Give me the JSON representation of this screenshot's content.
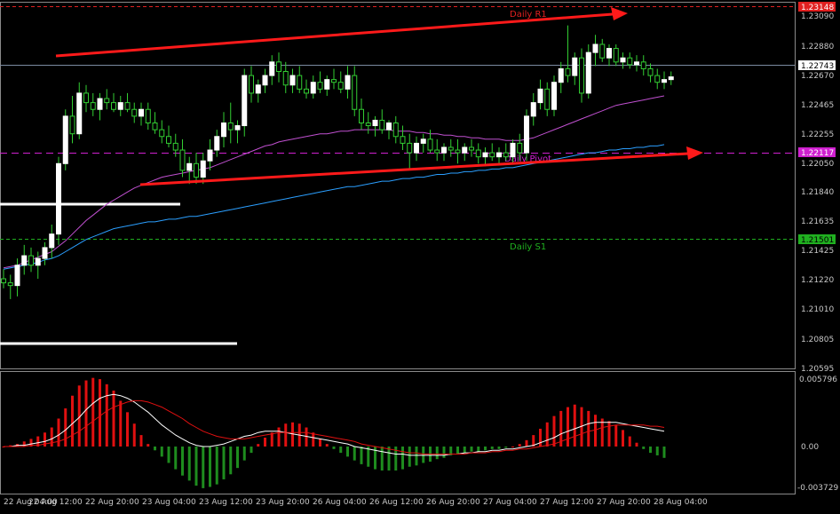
{
  "chart_data": [
    {
      "type": "candlestick",
      "panel": "price",
      "ylim": [
        1.20595,
        1.23255
      ],
      "price_labels": [
        "1.23090",
        "1.22880",
        "1.22670",
        "1.22465",
        "1.22255",
        "1.22050",
        "1.21840",
        "1.21635",
        "1.21425",
        "1.21220",
        "1.21010",
        "1.20805",
        "1.20595"
      ],
      "levels": [
        {
          "name": "Daily R1",
          "value": 1.23148,
          "label": "Daily R1",
          "tag": "1.23148",
          "color": "#e02020"
        },
        {
          "name": "current",
          "value": 1.22743,
          "label": "",
          "tag": "1.22743",
          "color": "#ffffff"
        },
        {
          "name": "Daily Pivot",
          "value": 1.22117,
          "label": "Daily Pivot",
          "tag": "1.22117",
          "color": "#d020d0"
        },
        {
          "name": "Daily S1",
          "value": 1.21501,
          "label": "Daily S1",
          "tag": "1.21501",
          "color": "#20b020"
        }
      ],
      "candles": [
        [
          1.2125,
          1.2132,
          1.2118,
          1.2122
        ],
        [
          1.2122,
          1.2128,
          1.211,
          1.212
        ],
        [
          1.212,
          1.214,
          1.2112,
          1.2135
        ],
        [
          1.2135,
          1.215,
          1.2128,
          1.2142
        ],
        [
          1.2142,
          1.2148,
          1.213,
          1.2135
        ],
        [
          1.2135,
          1.2145,
          1.2125,
          1.214
        ],
        [
          1.214,
          1.2152,
          1.2135,
          1.2148
        ],
        [
          1.2148,
          1.2165,
          1.214,
          1.2158
        ],
        [
          1.2158,
          1.2215,
          1.215,
          1.221
        ],
        [
          1.221,
          1.225,
          1.2205,
          1.2245
        ],
        [
          1.2245,
          1.226,
          1.2225,
          1.2232
        ],
        [
          1.2232,
          1.227,
          1.2228,
          1.2262
        ],
        [
          1.2262,
          1.2268,
          1.2248,
          1.2255
        ],
        [
          1.2255,
          1.2262,
          1.2245,
          1.225
        ],
        [
          1.225,
          1.2262,
          1.2242,
          1.2258
        ],
        [
          1.2258,
          1.2265,
          1.225,
          1.2255
        ],
        [
          1.2255,
          1.2262,
          1.2248,
          1.225
        ],
        [
          1.225,
          1.226,
          1.2245,
          1.2255
        ],
        [
          1.2255,
          1.2262,
          1.2248,
          1.225
        ],
        [
          1.225,
          1.2255,
          1.224,
          1.2245
        ],
        [
          1.2245,
          1.2255,
          1.2238,
          1.225
        ],
        [
          1.225,
          1.2255,
          1.2235,
          1.224
        ],
        [
          1.224,
          1.2248,
          1.2232,
          1.2235
        ],
        [
          1.2235,
          1.2242,
          1.2225,
          1.223
        ],
        [
          1.223,
          1.2238,
          1.2222,
          1.2225
        ],
        [
          1.2225,
          1.2232,
          1.2215,
          1.222
        ],
        [
          1.222,
          1.2228,
          1.22,
          1.2205
        ],
        [
          1.2205,
          1.2215,
          1.2195,
          1.221
        ],
        [
          1.221,
          1.2218,
          1.2195,
          1.22
        ],
        [
          1.22,
          1.2218,
          1.2195,
          1.2212
        ],
        [
          1.2212,
          1.2228,
          1.2205,
          1.222
        ],
        [
          1.222,
          1.2235,
          1.2215,
          1.223
        ],
        [
          1.223,
          1.2248,
          1.2222,
          1.224
        ],
        [
          1.224,
          1.2255,
          1.2225,
          1.2235
        ],
        [
          1.2235,
          1.2242,
          1.2225,
          1.2238
        ],
        [
          1.2238,
          1.228,
          1.223,
          1.2275
        ],
        [
          1.2275,
          1.2282,
          1.2255,
          1.2262
        ],
        [
          1.2262,
          1.2272,
          1.2255,
          1.2268
        ],
        [
          1.2268,
          1.228,
          1.2262,
          1.2275
        ],
        [
          1.2275,
          1.229,
          1.2268,
          1.2285
        ],
        [
          1.2285,
          1.2292,
          1.227,
          1.2278
        ],
        [
          1.2278,
          1.2285,
          1.2262,
          1.2268
        ],
        [
          1.2268,
          1.228,
          1.2262,
          1.2275
        ],
        [
          1.2275,
          1.2282,
          1.2262,
          1.2265
        ],
        [
          1.2265,
          1.2272,
          1.2258,
          1.2262
        ],
        [
          1.2262,
          1.2275,
          1.2258,
          1.227
        ],
        [
          1.227,
          1.2278,
          1.2262,
          1.2265
        ],
        [
          1.2265,
          1.2275,
          1.226,
          1.2272
        ],
        [
          1.2272,
          1.228,
          1.2265,
          1.227
        ],
        [
          1.227,
          1.2278,
          1.2262,
          1.2265
        ],
        [
          1.2265,
          1.2282,
          1.2258,
          1.2275
        ],
        [
          1.2275,
          1.2282,
          1.2245,
          1.225
        ],
        [
          1.225,
          1.2258,
          1.2235,
          1.224
        ],
        [
          1.224,
          1.2248,
          1.2232,
          1.2238
        ],
        [
          1.2238,
          1.2245,
          1.223,
          1.2242
        ],
        [
          1.2242,
          1.225,
          1.2232,
          1.2235
        ],
        [
          1.2235,
          1.2242,
          1.2228,
          1.224
        ],
        [
          1.224,
          1.2245,
          1.2225,
          1.223
        ],
        [
          1.223,
          1.2238,
          1.222,
          1.2225
        ],
        [
          1.2225,
          1.2232,
          1.2205,
          1.2218
        ],
        [
          1.2218,
          1.223,
          1.2212,
          1.2225
        ],
        [
          1.2225,
          1.2232,
          1.2218,
          1.2228
        ],
        [
          1.2228,
          1.2235,
          1.2218,
          1.222
        ],
        [
          1.222,
          1.2228,
          1.2212,
          1.2218
        ],
        [
          1.2218,
          1.2225,
          1.2212,
          1.2222
        ],
        [
          1.2222,
          1.2228,
          1.2215,
          1.222
        ],
        [
          1.222,
          1.2228,
          1.221,
          1.2218
        ],
        [
          1.2218,
          1.2225,
          1.2212,
          1.2222
        ],
        [
          1.2222,
          1.2228,
          1.2215,
          1.222
        ],
        [
          1.222,
          1.2225,
          1.221,
          1.2215
        ],
        [
          1.2215,
          1.2222,
          1.2208,
          1.2218
        ],
        [
          1.2218,
          1.2225,
          1.2212,
          1.2215
        ],
        [
          1.2215,
          1.2222,
          1.221,
          1.2218
        ],
        [
          1.2218,
          1.2225,
          1.2212,
          1.2215
        ],
        [
          1.2215,
          1.2228,
          1.221,
          1.2225
        ],
        [
          1.2225,
          1.2232,
          1.2212,
          1.2218
        ],
        [
          1.2218,
          1.225,
          1.2212,
          1.2245
        ],
        [
          1.2245,
          1.2262,
          1.2238,
          1.2255
        ],
        [
          1.2255,
          1.2272,
          1.225,
          1.2265
        ],
        [
          1.2265,
          1.227,
          1.2245,
          1.225
        ],
        [
          1.225,
          1.2275,
          1.2245,
          1.227
        ],
        [
          1.227,
          1.2285,
          1.2262,
          1.228
        ],
        [
          1.228,
          1.2312,
          1.227,
          1.2275
        ],
        [
          1.2275,
          1.2292,
          1.2268,
          1.2288
        ],
        [
          1.2288,
          1.2295,
          1.2255,
          1.2262
        ],
        [
          1.2262,
          1.2298,
          1.2258,
          1.2292
        ],
        [
          1.2292,
          1.2305,
          1.2282,
          1.2298
        ],
        [
          1.2298,
          1.2302,
          1.2285,
          1.2288
        ],
        [
          1.2288,
          1.2298,
          1.2282,
          1.2295
        ],
        [
          1.2295,
          1.2298,
          1.2282,
          1.2285
        ],
        [
          1.2285,
          1.2292,
          1.228,
          1.2288
        ],
        [
          1.2288,
          1.2292,
          1.228,
          1.2283
        ],
        [
          1.2283,
          1.229,
          1.2278,
          1.2285
        ],
        [
          1.2285,
          1.229,
          1.2275,
          1.228
        ],
        [
          1.228,
          1.2284,
          1.227,
          1.2275
        ],
        [
          1.2275,
          1.228,
          1.2265,
          1.227
        ],
        [
          1.227,
          1.2278,
          1.2265,
          1.2272
        ],
        [
          1.2272,
          1.2278,
          1.2268,
          1.2274
        ]
      ],
      "ma_slow": [
        1.2132,
        1.2133,
        1.2134,
        1.2135,
        1.2136,
        1.2137,
        1.2139,
        1.214,
        1.2142,
        1.2145,
        1.2148,
        1.2151,
        1.2154,
        1.2156,
        1.2158,
        1.216,
        1.2162,
        1.2163,
        1.2164,
        1.2165,
        1.2166,
        1.2167,
        1.2167,
        1.2168,
        1.2169,
        1.2169,
        1.217,
        1.2171,
        1.2171,
        1.2172,
        1.2173,
        1.2174,
        1.2175,
        1.2176,
        1.2177,
        1.2178,
        1.2179,
        1.218,
        1.2181,
        1.2182,
        1.2183,
        1.2184,
        1.2185,
        1.2186,
        1.2187,
        1.2188,
        1.2189,
        1.219,
        1.2191,
        1.2192,
        1.2193,
        1.2193,
        1.2194,
        1.2195,
        1.2196,
        1.2197,
        1.2197,
        1.2198,
        1.2199,
        1.2199,
        1.22,
        1.22,
        1.2201,
        1.2202,
        1.2202,
        1.2203,
        1.2203,
        1.2204,
        1.2204,
        1.2205,
        1.2205,
        1.2206,
        1.2206,
        1.2207,
        1.2207,
        1.2208,
        1.2209,
        1.221,
        1.2211,
        1.2212,
        1.2213,
        1.2214,
        1.2215,
        1.2216,
        1.2217,
        1.2218,
        1.2218,
        1.2219,
        1.222,
        1.222,
        1.2221,
        1.2221,
        1.2222,
        1.2222,
        1.2223,
        1.2223,
        1.2224
      ],
      "ma_mid": [
        1.2133,
        1.2134,
        1.2135,
        1.2137,
        1.2139,
        1.2141,
        1.2143,
        1.2145,
        1.2149,
        1.2153,
        1.2158,
        1.2163,
        1.2168,
        1.2172,
        1.2176,
        1.218,
        1.2183,
        1.2186,
        1.2189,
        1.2192,
        1.2194,
        1.2196,
        1.2198,
        1.22,
        1.2201,
        1.2202,
        1.2203,
        1.2204,
        1.2205,
        1.2206,
        1.2207,
        1.2209,
        1.2211,
        1.2213,
        1.2215,
        1.2217,
        1.2219,
        1.2221,
        1.2223,
        1.2224,
        1.2226,
        1.2227,
        1.2228,
        1.2229,
        1.223,
        1.2231,
        1.2232,
        1.2232,
        1.2233,
        1.2234,
        1.2234,
        1.2235,
        1.2235,
        1.2235,
        1.2235,
        1.2235,
        1.2235,
        1.2234,
        1.2234,
        1.2234,
        1.2233,
        1.2233,
        1.2232,
        1.2232,
        1.2231,
        1.2231,
        1.223,
        1.223,
        1.2229,
        1.2229,
        1.2228,
        1.2228,
        1.2228,
        1.2227,
        1.2227,
        1.2227,
        1.2228,
        1.2229,
        1.2231,
        1.2233,
        1.2235,
        1.2237,
        1.2239,
        1.2241,
        1.2243,
        1.2245,
        1.2247,
        1.2249,
        1.2251,
        1.2253,
        1.2254,
        1.2255,
        1.2256,
        1.2257,
        1.2258,
        1.2259,
        1.226
      ],
      "time_labels": [
        "22 Aug 04:00",
        "22 Aug 12:00",
        "22 Aug 20:00",
        "23 Aug 04:00",
        "23 Aug 12:00",
        "23 Aug 20:00",
        "26 Aug 04:00",
        "26 Aug 12:00",
        "26 Aug 20:00",
        "27 Aug 04:00",
        "27 Aug 12:00",
        "27 Aug 20:00",
        "28 Aug 04:00"
      ]
    },
    {
      "type": "histogram",
      "panel": "oscillator",
      "ylim": [
        -0.003729,
        0.005796
      ],
      "axis_labels": [
        "0.005796",
        "0.00",
        "-0.003729"
      ],
      "bars": [
        0.0,
        0.0001,
        0.0002,
        0.0004,
        0.0006,
        0.0008,
        0.0011,
        0.0015,
        0.0022,
        0.003,
        0.004,
        0.0048,
        0.0052,
        0.0054,
        0.0053,
        0.0049,
        0.0044,
        0.0036,
        0.0027,
        0.0018,
        0.0009,
        0.0002,
        -0.0003,
        -0.0008,
        -0.0013,
        -0.0018,
        -0.0023,
        -0.0027,
        -0.0031,
        -0.0033,
        -0.0032,
        -0.003,
        -0.0026,
        -0.0022,
        -0.0017,
        -0.0011,
        -0.0005,
        0.0002,
        0.0007,
        0.0011,
        0.0015,
        0.0018,
        0.0019,
        0.0018,
        0.0015,
        0.0011,
        0.0006,
        0.0002,
        -0.0002,
        -0.0005,
        -0.0008,
        -0.0011,
        -0.0014,
        -0.0016,
        -0.0018,
        -0.0019,
        -0.0019,
        -0.0019,
        -0.0018,
        -0.0016,
        -0.0015,
        -0.0013,
        -0.0012,
        -0.001,
        -0.0009,
        -0.0007,
        -0.0006,
        -0.0005,
        -0.0004,
        -0.0004,
        -0.0003,
        -0.0002,
        -0.0002,
        -0.0001,
        0.0,
        0.0002,
        0.0005,
        0.0009,
        0.0014,
        0.0019,
        0.0024,
        0.0028,
        0.0031,
        0.0033,
        0.0031,
        0.0028,
        0.0025,
        0.0022,
        0.002,
        0.0017,
        0.0013,
        0.0008,
        0.0003,
        -0.0002,
        -0.0005,
        -0.0007,
        -0.0009
      ],
      "signal": [
        0.0,
        0.0,
        0.0001,
        0.0001,
        0.0002,
        0.0003,
        0.0004,
        0.0006,
        0.0009,
        0.0013,
        0.0018,
        0.0023,
        0.0029,
        0.0034,
        0.0038,
        0.004,
        0.0041,
        0.004,
        0.0038,
        0.0035,
        0.0031,
        0.0027,
        0.0022,
        0.0017,
        0.0013,
        0.0009,
        0.0006,
        0.0003,
        0.0001,
        0.0,
        0.0,
        0.0001,
        0.0002,
        0.0004,
        0.0006,
        0.0008,
        0.0009,
        0.0011,
        0.0012,
        0.0012,
        0.0012,
        0.0011,
        0.001,
        0.0009,
        0.0008,
        0.0007,
        0.0006,
        0.0005,
        0.0004,
        0.0003,
        0.0002,
        0.0,
        -0.0001,
        -0.0002,
        -0.0003,
        -0.0004,
        -0.0005,
        -0.0006,
        -0.0006,
        -0.0007,
        -0.0007,
        -0.0007,
        -0.0007,
        -0.0007,
        -0.0007,
        -0.0006,
        -0.0006,
        -0.0005,
        -0.0005,
        -0.0004,
        -0.0004,
        -0.0003,
        -0.0003,
        -0.0002,
        -0.0002,
        -0.0001,
        0.0,
        0.0001,
        0.0003,
        0.0005,
        0.0007,
        0.001,
        0.0012,
        0.0014,
        0.0016,
        0.0018,
        0.0019,
        0.0019,
        0.0019,
        0.0019,
        0.0018,
        0.0017,
        0.0016,
        0.0015,
        0.0014,
        0.0013,
        0.0012
      ],
      "trigger": [
        0.0,
        0.0,
        0.0,
        0.0,
        0.0001,
        0.0001,
        0.0002,
        0.0003,
        0.0004,
        0.0006,
        0.0009,
        0.0012,
        0.0016,
        0.002,
        0.0024,
        0.0028,
        0.0031,
        0.0033,
        0.0035,
        0.0036,
        0.0036,
        0.0035,
        0.0033,
        0.0031,
        0.0028,
        0.0025,
        0.0022,
        0.0018,
        0.0015,
        0.0012,
        0.001,
        0.0008,
        0.0007,
        0.0006,
        0.0006,
        0.0006,
        0.0007,
        0.0008,
        0.0009,
        0.001,
        0.0011,
        0.0011,
        0.0011,
        0.0011,
        0.0011,
        0.001,
        0.0009,
        0.0008,
        0.0007,
        0.0006,
        0.0005,
        0.0004,
        0.0002,
        0.0001,
        0.0,
        -0.0001,
        -0.0002,
        -0.0003,
        -0.0004,
        -0.0005,
        -0.0005,
        -0.0006,
        -0.0006,
        -0.0006,
        -0.0006,
        -0.0006,
        -0.0006,
        -0.0006,
        -0.0005,
        -0.0005,
        -0.0005,
        -0.0004,
        -0.0004,
        -0.0003,
        -0.0003,
        -0.0002,
        -0.0002,
        -0.0001,
        0.0,
        0.0001,
        0.0002,
        0.0004,
        0.0006,
        0.0008,
        0.001,
        0.0012,
        0.0013,
        0.0015,
        0.0016,
        0.0017,
        0.0017,
        0.0017,
        0.0017,
        0.0017,
        0.0016,
        0.0016,
        0.0015
      ]
    }
  ],
  "colors": {
    "background": "#000000",
    "axis": "#c8c8c8",
    "bull_body": "#ffffff",
    "bear_body": "#000000",
    "wick": "#32cd32",
    "ma_slow": "#2b9fff",
    "ma_mid": "#c050d0",
    "hist_pos": "#e01010",
    "hist_neg": "#1e8c1e",
    "signal": "#ffffff",
    "trigger": "#e01010",
    "arrow": "#ff1a1a"
  }
}
